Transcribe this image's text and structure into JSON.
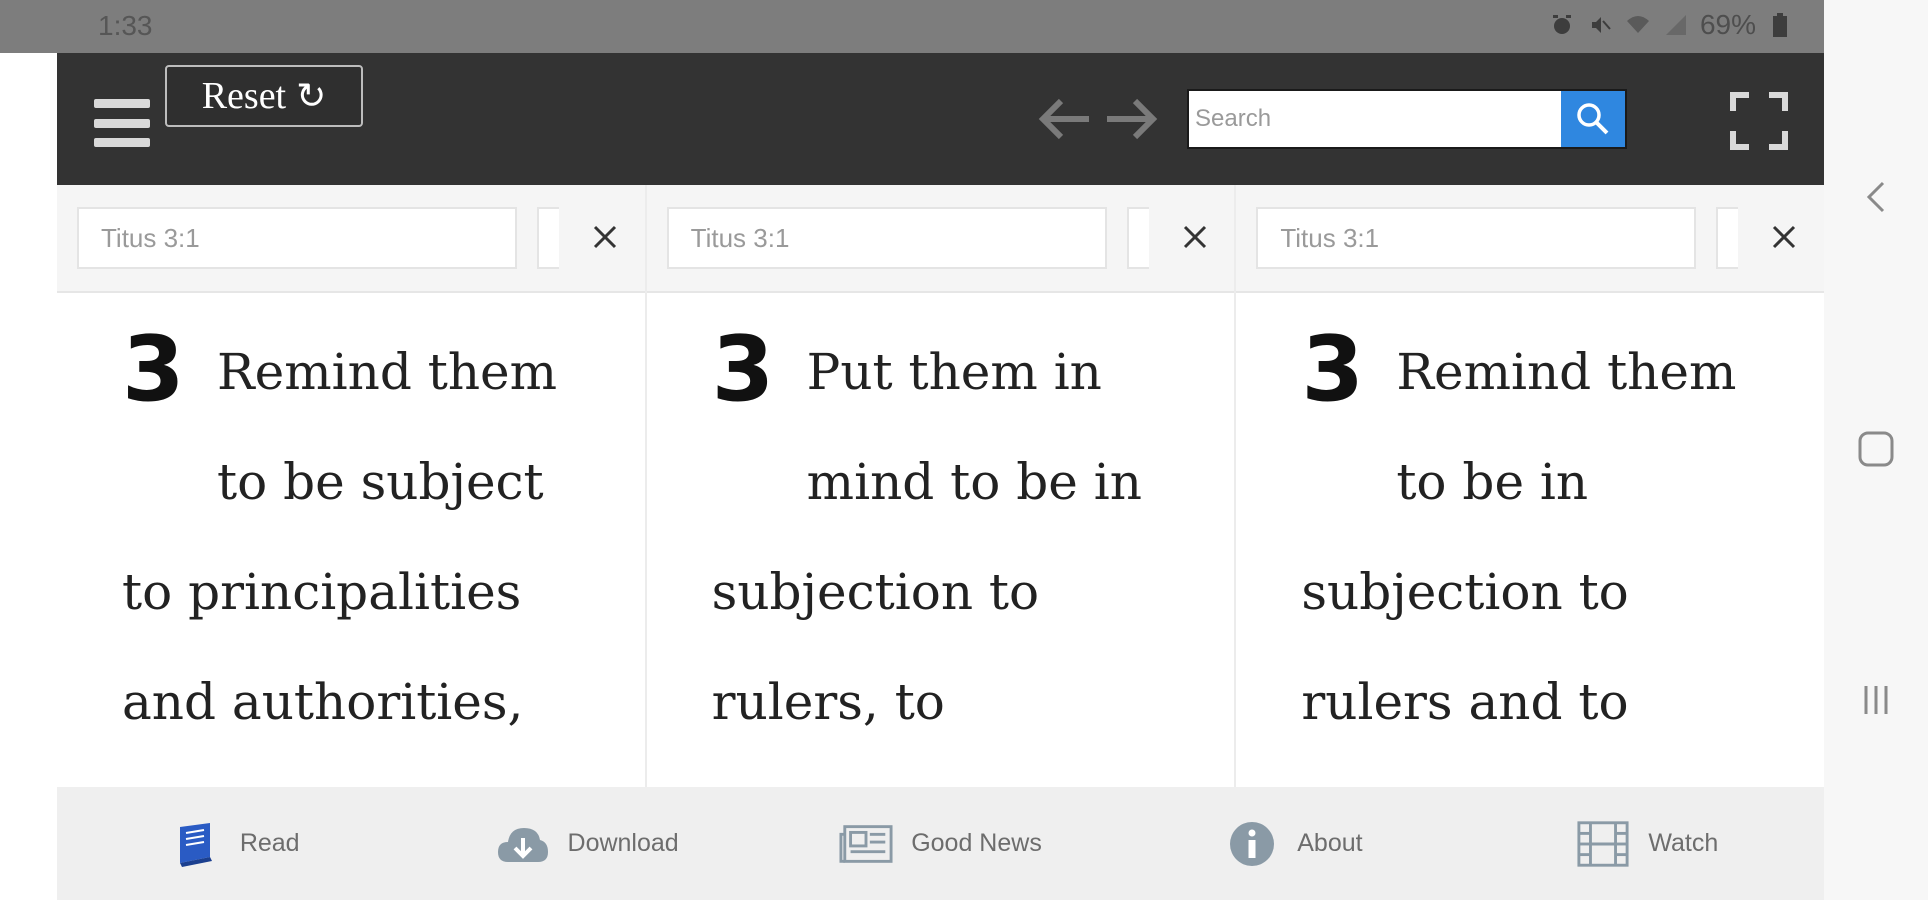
{
  "status_bar": {
    "time": "1:33",
    "battery": "69%"
  },
  "toolbar": {
    "reset_label": "Reset",
    "reset_icon": "↻",
    "search_placeholder": "Search"
  },
  "columns": [
    {
      "reference": "Titus 3:1",
      "chapter": "3",
      "lines": [
        "Remind them",
        "to be subject",
        "to principalities",
        "and authorities,"
      ]
    },
    {
      "reference": "Titus 3:1",
      "chapter": "3",
      "lines": [
        "Put them in",
        "mind to be in",
        "subjection to",
        "rulers, to"
      ]
    },
    {
      "reference": "Titus 3:1",
      "chapter": "3",
      "lines": [
        "Remind them",
        "to be in",
        "subjection to",
        "rulers and to"
      ]
    }
  ],
  "bottom_nav": [
    {
      "label": "Read",
      "icon": "book-icon",
      "color": "#2a5bc4"
    },
    {
      "label": "Download",
      "icon": "cloud-download-icon",
      "color": "#8a9aa6"
    },
    {
      "label": "Good News",
      "icon": "newspaper-icon",
      "color": "#8a9aa6"
    },
    {
      "label": "About",
      "icon": "info-icon",
      "color": "#8a9aa6"
    },
    {
      "label": "Watch",
      "icon": "film-icon",
      "color": "#8a9aa6"
    }
  ],
  "colors": {
    "toolbar_bg": "#333333",
    "search_button": "#2f87e0",
    "read_icon": "#2a5bc4"
  }
}
